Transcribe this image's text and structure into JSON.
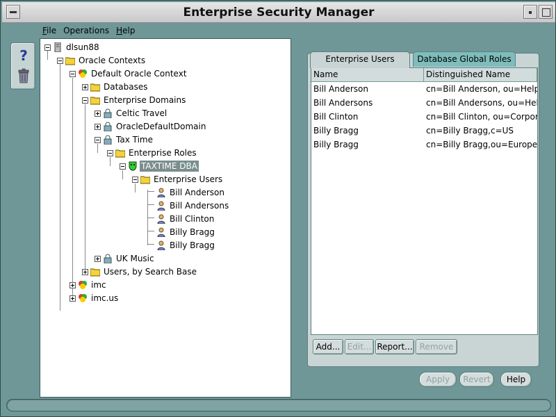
{
  "window": {
    "title": "Enterprise Security Manager"
  },
  "menu": [
    {
      "mnemonic": "F",
      "rest": "ile"
    },
    {
      "mnemonic": "",
      "rest": "Operations"
    },
    {
      "mnemonic": "H",
      "rest": "elp"
    }
  ],
  "toolbox": {
    "help_icon": "question-mark-icon",
    "trash_icon": "trash-can-icon"
  },
  "tree": {
    "root": "dlsun88",
    "oracle_contexts": "Oracle Contexts",
    "default_context": "Default Oracle Context",
    "databases": "Databases",
    "enterprise_domains": "Enterprise Domains",
    "celtic_travel": "Celtic Travel",
    "oracle_default_domain": "OracleDefaultDomain",
    "tax_time": "Tax Time",
    "enterprise_roles": "Enterprise Roles",
    "taxtime_dba": "TAXTIME DBA",
    "enterprise_users": "Enterprise Users",
    "users": [
      "Bill Anderson",
      "Bill Andersons",
      "Bill Clinton",
      "Billy Bragg",
      "Billy Bragg"
    ],
    "uk_music": "UK Music",
    "users_by_search_base": "Users, by Search Base",
    "imc": "imc",
    "imc_us": "imc.us"
  },
  "tabs": {
    "enterprise_users": "Enterprise Users",
    "database_global_roles": "Database Global Roles"
  },
  "table": {
    "headers": {
      "name": "Name",
      "dn": "Distinguished Name"
    },
    "rows": [
      {
        "name": "Bill Anderson",
        "dn": "cn=Bill Anderson, ou=Help"
      },
      {
        "name": "Bill Andersons",
        "dn": "cn=Bill Andersons, ou=Hel"
      },
      {
        "name": "Bill Clinton",
        "dn": "cn=Bill Clinton, ou=Corpor"
      },
      {
        "name": "Billy Bragg",
        "dn": "cn=Billy Bragg,c=US"
      },
      {
        "name": "Billy Bragg",
        "dn": "cn=Billy Bragg,ou=Europe,c"
      }
    ]
  },
  "buttons": {
    "add": "Add...",
    "edit": "Edit...",
    "report": "Report...",
    "remove": "Remove",
    "apply": "Apply",
    "revert": "Revert",
    "help": "Help"
  },
  "colors": {
    "selection": "#7b8e8e",
    "inactive_tab": "#7fbcbc",
    "background": "#6f9797"
  }
}
